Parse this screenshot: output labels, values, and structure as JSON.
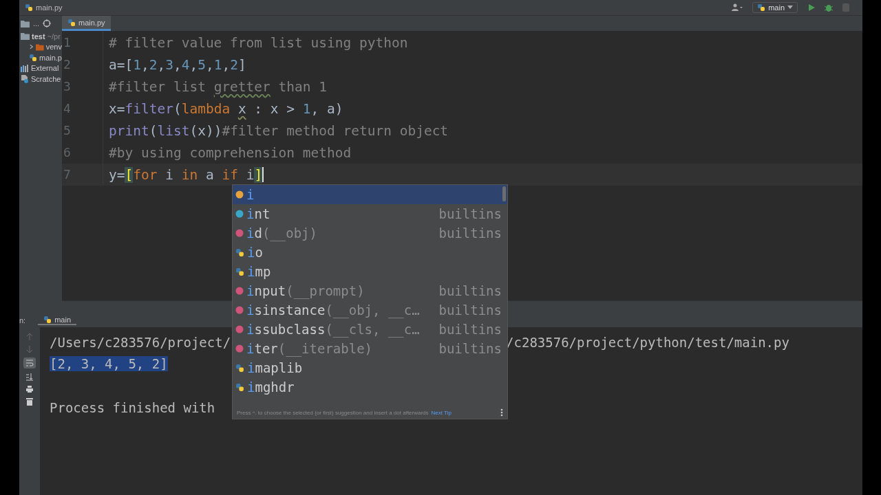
{
  "topbar": {
    "file": "main.py",
    "run_config": "main"
  },
  "project": {
    "header": "...",
    "tree": [
      {
        "label": "test",
        "hint": "~/pr",
        "kind": "folder",
        "children": [
          {
            "label": "venv",
            "kind": "venv",
            "expanded": false
          },
          {
            "label": "main.p",
            "kind": "python"
          }
        ]
      },
      {
        "label": "External",
        "kind": "library"
      },
      {
        "label": "Scratche",
        "kind": "scratch"
      }
    ]
  },
  "editor": {
    "tab": {
      "label": "main.py",
      "selected": true
    },
    "lines": [
      {
        "number": "1",
        "current": false,
        "tokens": [
          {
            "text": "# filter value from list using python",
            "kind": "comment"
          }
        ]
      },
      {
        "number": "2",
        "current": false,
        "tokens": [
          {
            "text": "a=[",
            "kind": "plain"
          },
          {
            "text": "1",
            "kind": "number"
          },
          {
            "text": ",",
            "kind": "plain"
          },
          {
            "text": "2",
            "kind": "number"
          },
          {
            "text": ",",
            "kind": "plain"
          },
          {
            "text": "3",
            "kind": "number"
          },
          {
            "text": ",",
            "kind": "plain"
          },
          {
            "text": "4",
            "kind": "number"
          },
          {
            "text": ",",
            "kind": "plain"
          },
          {
            "text": "5",
            "kind": "number"
          },
          {
            "text": ",",
            "kind": "plain"
          },
          {
            "text": "1",
            "kind": "number"
          },
          {
            "text": ",",
            "kind": "plain"
          },
          {
            "text": "2",
            "kind": "number"
          },
          {
            "text": "]",
            "kind": "plain"
          }
        ]
      },
      {
        "number": "3",
        "current": false,
        "tokens": [
          {
            "text": "#filter list ",
            "kind": "comment"
          },
          {
            "text": "gretter",
            "kind": "typo"
          },
          {
            "text": " than 1",
            "kind": "comment"
          }
        ]
      },
      {
        "number": "4",
        "current": false,
        "tokens": [
          {
            "text": "x=",
            "kind": "plain"
          },
          {
            "text": "filter",
            "kind": "builtin"
          },
          {
            "text": "(",
            "kind": "plain"
          },
          {
            "text": "lambda ",
            "kind": "keyword"
          },
          {
            "text": "x",
            "kind": "weak"
          },
          {
            "text": " : x > ",
            "kind": "plain"
          },
          {
            "text": "1",
            "kind": "number"
          },
          {
            "text": ", a)",
            "kind": "plain"
          }
        ]
      },
      {
        "number": "5",
        "current": false,
        "tokens": [
          {
            "text": "print",
            "kind": "builtin"
          },
          {
            "text": "(",
            "kind": "plain"
          },
          {
            "text": "list",
            "kind": "builtin"
          },
          {
            "text": "(x))",
            "kind": "plain"
          },
          {
            "text": "#filter method return object",
            "kind": "comment"
          }
        ]
      },
      {
        "number": "6",
        "current": false,
        "tokens": [
          {
            "text": "#by using comprehension method",
            "kind": "comment"
          }
        ]
      },
      {
        "number": "7",
        "current": true,
        "tokens": [
          {
            "text": "y=",
            "kind": "plain"
          },
          {
            "text": "[",
            "kind": "bracket"
          },
          {
            "text": "for",
            "kind": "keyword"
          },
          {
            "text": " i ",
            "kind": "plain"
          },
          {
            "text": "in",
            "kind": "keyword"
          },
          {
            "text": " a ",
            "kind": "plain"
          },
          {
            "text": "if ",
            "kind": "keyword"
          },
          {
            "text": "i",
            "kind": "plain"
          },
          {
            "text": "]",
            "kind": "bracket"
          }
        ]
      }
    ]
  },
  "completion": {
    "items": [
      {
        "match": "i",
        "kind": "variable",
        "selected": true
      },
      {
        "match": "i",
        "rest": "nt",
        "source": "builtins",
        "kind": "class",
        "selected": false
      },
      {
        "match": "i",
        "rest": "d",
        "params": "(__obj)",
        "source": "builtins",
        "kind": "function",
        "selected": false
      },
      {
        "match": "i",
        "rest": "o",
        "kind": "module",
        "selected": false
      },
      {
        "match": "i",
        "rest": "mp",
        "kind": "module",
        "selected": false
      },
      {
        "match": "i",
        "rest": "nput",
        "params": "(__prompt)",
        "source": "builtins",
        "kind": "function",
        "selected": false
      },
      {
        "match": "i",
        "rest": "sinstance",
        "params": "(__obj, __c…",
        "source": "builtins",
        "kind": "function",
        "selected": false
      },
      {
        "match": "i",
        "rest": "ssubclass",
        "params": "(__cls, __c…",
        "source": "builtins",
        "kind": "function",
        "selected": false
      },
      {
        "match": "i",
        "rest": "ter",
        "params": "(__iterable)",
        "source": "builtins",
        "kind": "function",
        "selected": false
      },
      {
        "match": "i",
        "rest": "maplib",
        "kind": "module",
        "selected": false
      },
      {
        "match": "i",
        "rest": "mghdr",
        "kind": "module",
        "selected": false
      }
    ],
    "hint": "Press ^. to choose the selected (or first) suggestion and insert a dot afterwards",
    "link": "Next Tip"
  },
  "run": {
    "label": "n:",
    "tab": "main",
    "output": [
      {
        "kind": "path",
        "parts": [
          "/Users/c283576/project/",
          "/c283576/project/python/test/main.py"
        ]
      },
      {
        "kind": "selected",
        "text": "[2, 3, 4, 5, 2]"
      },
      {
        "kind": "exit",
        "text": "Process finished with"
      }
    ]
  }
}
